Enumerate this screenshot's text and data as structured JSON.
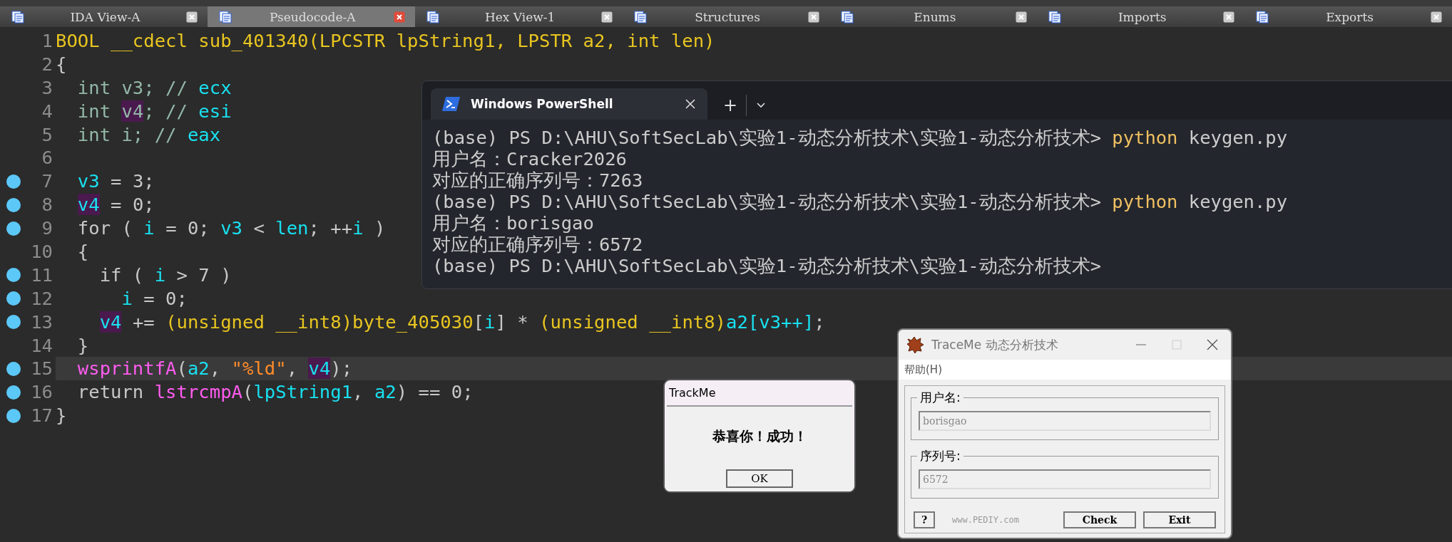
{
  "tabs": [
    {
      "label": "IDA View-A",
      "selected": false
    },
    {
      "label": "Pseudocode-A",
      "selected": true
    },
    {
      "label": "Hex View-1",
      "selected": false
    },
    {
      "label": "Structures",
      "selected": false
    },
    {
      "label": "Enums",
      "selected": false
    },
    {
      "label": "Imports",
      "selected": false
    },
    {
      "label": "Exports",
      "selected": false
    }
  ],
  "code": {
    "lines": [
      {
        "number": "1",
        "breakpoint": false,
        "current": false,
        "tokens": [
          {
            "text": "BOOL __cdecl sub_401340(LPCSTR lpString1, LPSTR a2, int len)",
            "kind": "decl"
          }
        ]
      },
      {
        "number": "2",
        "breakpoint": false,
        "current": false,
        "tokens": [
          {
            "text": "{",
            "kind": "plain"
          }
        ]
      },
      {
        "number": "3",
        "breakpoint": false,
        "current": false,
        "tokens": [
          {
            "text": "  int v3; // ",
            "kind": "type"
          },
          {
            "text": "ecx",
            "kind": "var"
          }
        ]
      },
      {
        "number": "4",
        "breakpoint": false,
        "current": false,
        "tokens": [
          {
            "text": "  int ",
            "kind": "type"
          },
          {
            "text": "v4",
            "kind": "marked-type"
          },
          {
            "text": "; // ",
            "kind": "type"
          },
          {
            "text": "esi",
            "kind": "var"
          }
        ]
      },
      {
        "number": "5",
        "breakpoint": false,
        "current": false,
        "tokens": [
          {
            "text": "  int i; // ",
            "kind": "type"
          },
          {
            "text": "eax",
            "kind": "var"
          }
        ]
      },
      {
        "number": "6",
        "breakpoint": false,
        "current": false
      },
      {
        "number": "7",
        "breakpoint": true,
        "current": false,
        "tokens": [
          {
            "text": "  v3",
            "kind": "var"
          },
          {
            "text": " = 3;",
            "kind": "plain"
          }
        ]
      },
      {
        "number": "8",
        "breakpoint": true,
        "current": false,
        "tokens": [
          {
            "text": "  v4",
            "kind": "marked"
          },
          {
            "text": " = 0;",
            "kind": "plain"
          }
        ]
      },
      {
        "number": "9",
        "breakpoint": true,
        "current": false,
        "tokens": [
          {
            "text": "  for ( ",
            "kind": "plain"
          },
          {
            "text": "i",
            "kind": "var"
          },
          {
            "text": " = 0; ",
            "kind": "plain"
          },
          {
            "text": "v3",
            "kind": "var"
          },
          {
            "text": " < ",
            "kind": "plain"
          },
          {
            "text": "len",
            "kind": "var"
          },
          {
            "text": "; ++",
            "kind": "plain"
          },
          {
            "text": "i",
            "kind": "var"
          },
          {
            "text": " )",
            "kind": "plain"
          }
        ]
      },
      {
        "number": "10",
        "breakpoint": false,
        "current": false,
        "tokens": [
          {
            "text": "  {",
            "kind": "plain"
          }
        ]
      },
      {
        "number": "11",
        "breakpoint": true,
        "current": false,
        "tokens": [
          {
            "text": "    if ( ",
            "kind": "plain"
          },
          {
            "text": "i",
            "kind": "var"
          },
          {
            "text": " > 7 )",
            "kind": "plain"
          }
        ]
      },
      {
        "number": "12",
        "breakpoint": true,
        "current": false,
        "tokens": [
          {
            "text": "      i",
            "kind": "var"
          },
          {
            "text": " = 0;",
            "kind": "plain"
          }
        ]
      },
      {
        "number": "13",
        "breakpoint": true,
        "current": false,
        "tokens": [
          {
            "text": "    v4",
            "kind": "marked"
          },
          {
            "text": " += ",
            "kind": "plain"
          },
          {
            "text": "(unsigned __int8)byte_405030",
            "kind": "decl"
          },
          {
            "text": "[",
            "kind": "plain"
          },
          {
            "text": "i",
            "kind": "var"
          },
          {
            "text": "] * ",
            "kind": "plain"
          },
          {
            "text": "(unsigned __int8)",
            "kind": "decl"
          },
          {
            "text": "a2[v3++]",
            "kind": "var"
          },
          {
            "text": ";",
            "kind": "plain"
          }
        ]
      },
      {
        "number": "14",
        "breakpoint": false,
        "current": false,
        "tokens": [
          {
            "text": "  }",
            "kind": "plain"
          }
        ]
      },
      {
        "number": "15",
        "breakpoint": true,
        "current": true,
        "tokens": [
          {
            "text": "  wsprintfA",
            "kind": "func"
          },
          {
            "text": "(",
            "kind": "plain"
          },
          {
            "text": "a2",
            "kind": "var"
          },
          {
            "text": ", ",
            "kind": "plain"
          },
          {
            "text": "\"%ld\"",
            "kind": "string"
          },
          {
            "text": ", ",
            "kind": "plain"
          },
          {
            "text": "v4",
            "kind": "marked"
          },
          {
            "text": ");",
            "kind": "plain"
          }
        ]
      },
      {
        "number": "16",
        "breakpoint": true,
        "current": false,
        "tokens": [
          {
            "text": "  return ",
            "kind": "plain"
          },
          {
            "text": "lstrcmpA",
            "kind": "func"
          },
          {
            "text": "(",
            "kind": "plain"
          },
          {
            "text": "lpString1",
            "kind": "var"
          },
          {
            "text": ", ",
            "kind": "plain"
          },
          {
            "text": "a2",
            "kind": "var"
          },
          {
            "text": ") == 0;",
            "kind": "plain"
          }
        ]
      },
      {
        "number": "17",
        "breakpoint": true,
        "current": false,
        "tokens": [
          {
            "text": "}",
            "kind": "plain"
          }
        ]
      }
    ]
  },
  "terminal": {
    "tab_title": "Windows PowerShell",
    "new_tab": "+",
    "lines": [
      {
        "tokens": [
          {
            "text": "(base) PS D:\\AHU\\SoftSecLab\\实验1-动态分析技术\\实验1-动态分析技术> ",
            "kind": "plain"
          },
          {
            "text": "python",
            "kind": "command"
          },
          {
            "text": " keygen.py",
            "kind": "plain"
          }
        ]
      },
      {
        "tokens": [
          {
            "text": "用户名：Cracker2026",
            "kind": "plain"
          }
        ]
      },
      {
        "tokens": [
          {
            "text": "对应的正确序列号：7263",
            "kind": "plain"
          }
        ]
      },
      {
        "tokens": [
          {
            "text": "(base) PS D:\\AHU\\SoftSecLab\\实验1-动态分析技术\\实验1-动态分析技术> ",
            "kind": "plain"
          },
          {
            "text": "python",
            "kind": "command"
          },
          {
            "text": " keygen.py",
            "kind": "plain"
          }
        ]
      },
      {
        "tokens": [
          {
            "text": "用户名：borisgao",
            "kind": "plain"
          }
        ]
      },
      {
        "tokens": [
          {
            "text": "对应的正确序列号：6572",
            "kind": "plain"
          }
        ]
      },
      {
        "tokens": [
          {
            "text": "(base) PS D:\\AHU\\SoftSecLab\\实验1-动态分析技术\\实验1-动态分析技术>",
            "kind": "plain"
          }
        ]
      }
    ]
  },
  "message_box": {
    "title": "TrackMe",
    "message": "恭喜你！成功！",
    "button": "OK"
  },
  "traceme": {
    "title": "TraceMe 动态分析技术",
    "menu": "帮助(H)",
    "fields": [
      {
        "label": "用户名:",
        "value": "borisgao"
      },
      {
        "label": "序列号:",
        "value": "6572"
      }
    ],
    "help_button": "?",
    "site": "www.PEDIY.com",
    "buttons": [
      "Check",
      "Exit"
    ]
  }
}
